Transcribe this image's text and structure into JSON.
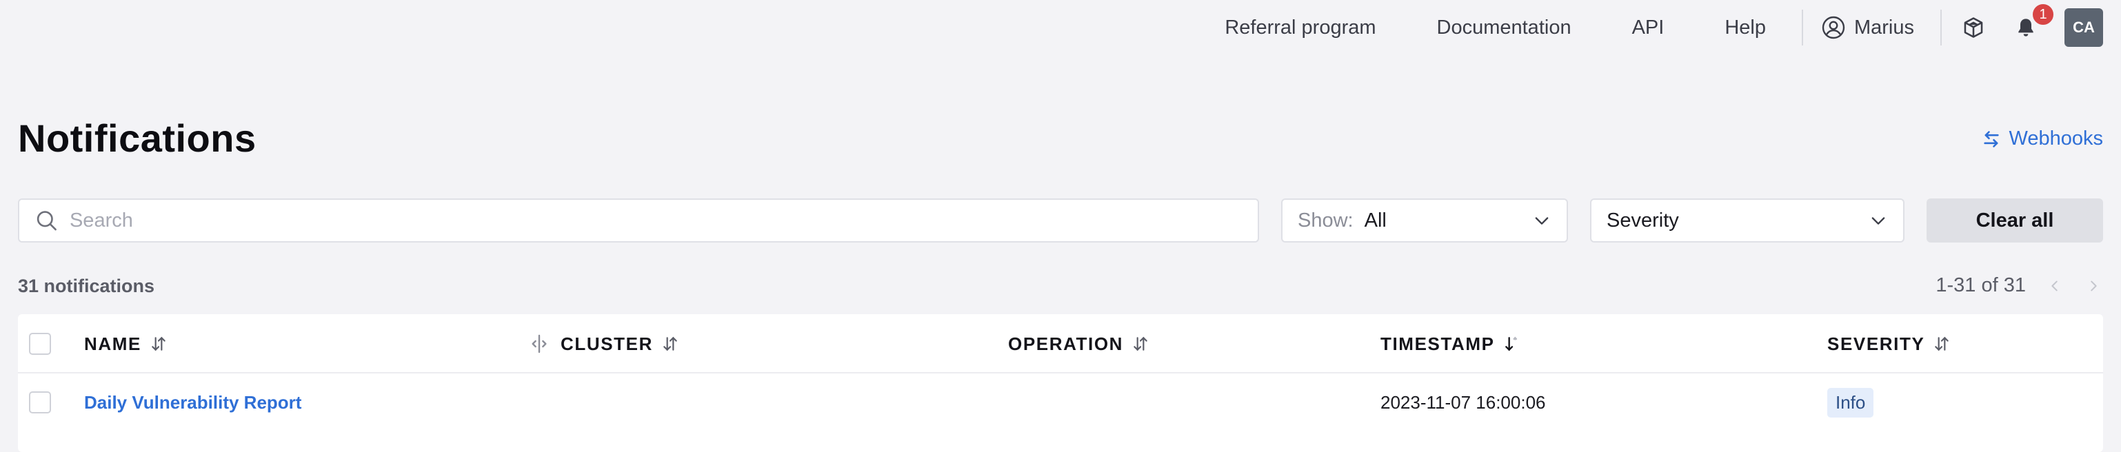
{
  "topnav": {
    "links": [
      "Referral program",
      "Documentation",
      "API",
      "Help"
    ],
    "user_name": "Marius",
    "notification_count": "1",
    "avatar_initials": "CA"
  },
  "header": {
    "title": "Notifications",
    "webhooks_label": "Webhooks"
  },
  "filters": {
    "search_placeholder": "Search",
    "show_label": "Show:",
    "show_value": "All",
    "severity_value": "Severity",
    "clear_label": "Clear all"
  },
  "summary": {
    "count_text": "31 notifications",
    "pagination_text": "1-31 of 31"
  },
  "table": {
    "columns": [
      "NAME",
      "CLUSTER",
      "OPERATION",
      "TIMESTAMP",
      "SEVERITY"
    ],
    "rows": [
      {
        "name": "Daily Vulnerability Report",
        "cluster": "",
        "operation": "",
        "timestamp": "2023-11-07 16:00:06",
        "severity": "Info"
      }
    ]
  },
  "colors": {
    "accent": "#2f6fd6",
    "background": "#f3f3f6",
    "badge_red": "#d84545",
    "avatar_bg": "#5b6470"
  },
  "icons": [
    "user-circle-icon",
    "cube-icon",
    "bell-icon",
    "swap-arrows-icon",
    "search-icon",
    "chevron-down-icon",
    "sort-icon",
    "column-resize-icon",
    "chevron-left-icon",
    "chevron-right-icon"
  ]
}
